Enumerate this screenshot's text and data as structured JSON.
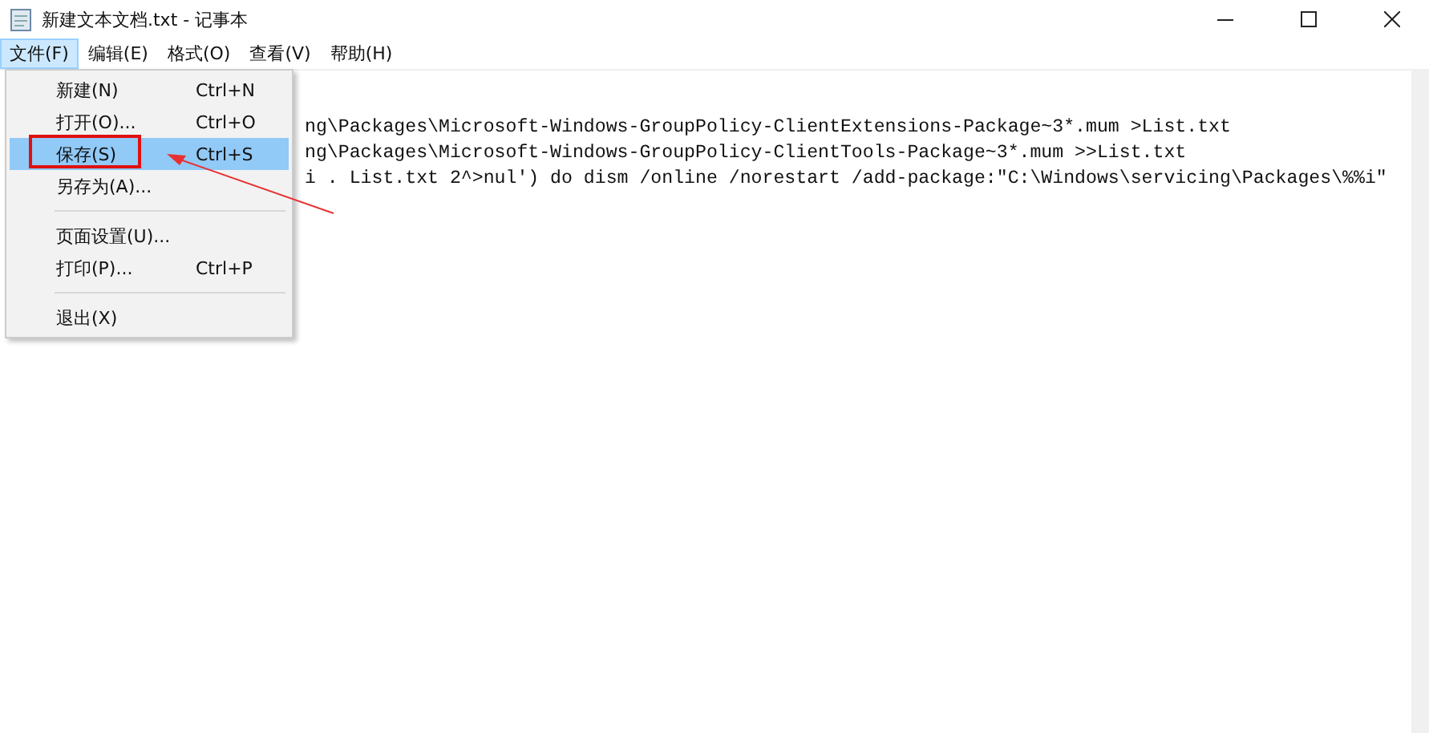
{
  "window": {
    "title": "新建文本文档.txt - 记事本"
  },
  "menubar": [
    {
      "label": "文件(F)",
      "selected": true
    },
    {
      "label": "编辑(E)",
      "selected": false
    },
    {
      "label": "格式(O)",
      "selected": false
    },
    {
      "label": "查看(V)",
      "selected": false
    },
    {
      "label": "帮助(H)",
      "selected": false
    }
  ],
  "file_menu": [
    {
      "kind": "item",
      "label": "新建(N)",
      "shortcut": "Ctrl+N",
      "selected": false
    },
    {
      "kind": "item",
      "label": "打开(O)...",
      "shortcut": "Ctrl+O",
      "selected": false
    },
    {
      "kind": "item",
      "label": "保存(S)",
      "shortcut": "Ctrl+S",
      "selected": true
    },
    {
      "kind": "item",
      "label": "另存为(A)...",
      "selected": false
    },
    {
      "kind": "separator"
    },
    {
      "kind": "item",
      "label": "页面设置(U)...",
      "selected": false
    },
    {
      "kind": "item",
      "label": "打印(P)...",
      "shortcut": "Ctrl+P",
      "selected": false
    },
    {
      "kind": "separator"
    },
    {
      "kind": "item",
      "label": "退出(X)",
      "selected": false
    }
  ],
  "editor_lines": [
    "ng\\Packages\\Microsoft-Windows-GroupPolicy-ClientExtensions-Package~3*.mum >List.txt",
    "ng\\Packages\\Microsoft-Windows-GroupPolicy-ClientTools-Package~3*.mum >>List.txt",
    "i . List.txt 2^>nul') do dism /online /norestart /add-package:\"C:\\Windows\\servicing\\Packages\\%%i\""
  ]
}
